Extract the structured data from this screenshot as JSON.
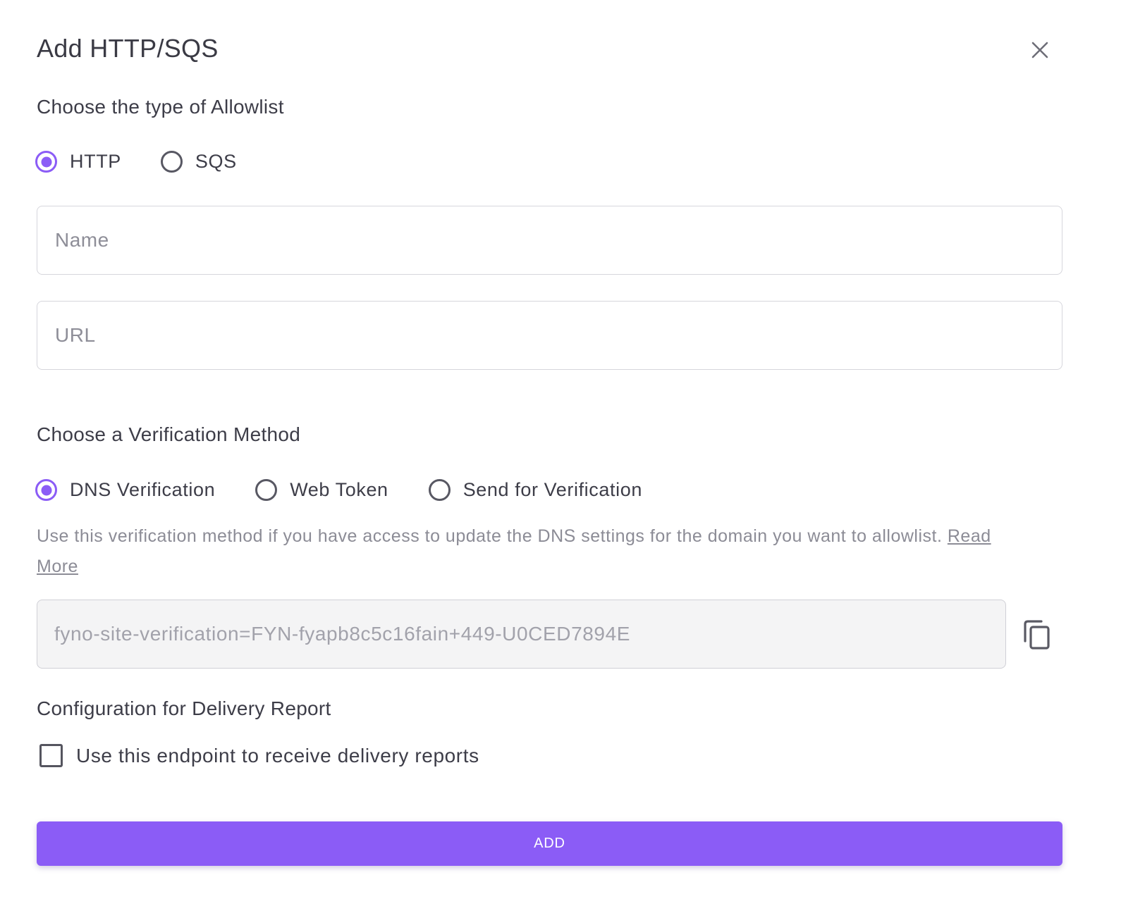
{
  "dialog": {
    "title": "Add HTTP/SQS"
  },
  "allowlist_type": {
    "heading": "Choose the type of Allowlist",
    "options": [
      {
        "label": "HTTP",
        "selected": true
      },
      {
        "label": "SQS",
        "selected": false
      }
    ]
  },
  "fields": {
    "name_placeholder": "Name",
    "name_value": "",
    "url_placeholder": "URL",
    "url_value": ""
  },
  "verification": {
    "heading": "Choose a Verification Method",
    "options": [
      {
        "label": "DNS Verification",
        "selected": true
      },
      {
        "label": "Web Token",
        "selected": false
      },
      {
        "label": "Send for Verification",
        "selected": false
      }
    ],
    "help_text": "Use this verification method if you have access to update the DNS settings for the domain you want to allowlist.",
    "read_more": "Read More",
    "token_value": "fyno-site-verification=FYN-fyapb8c5c16fain+449-U0CED7894E"
  },
  "delivery_report": {
    "heading": "Configuration for Delivery Report",
    "checkbox_label": "Use this endpoint to receive delivery reports",
    "checked": false
  },
  "actions": {
    "add_label": "ADD"
  },
  "colors": {
    "accent": "#8b5cf6",
    "text": "#3d3d48",
    "muted": "#8c8c96"
  },
  "icons": {
    "close": "close-icon",
    "copy": "copy-icon"
  }
}
